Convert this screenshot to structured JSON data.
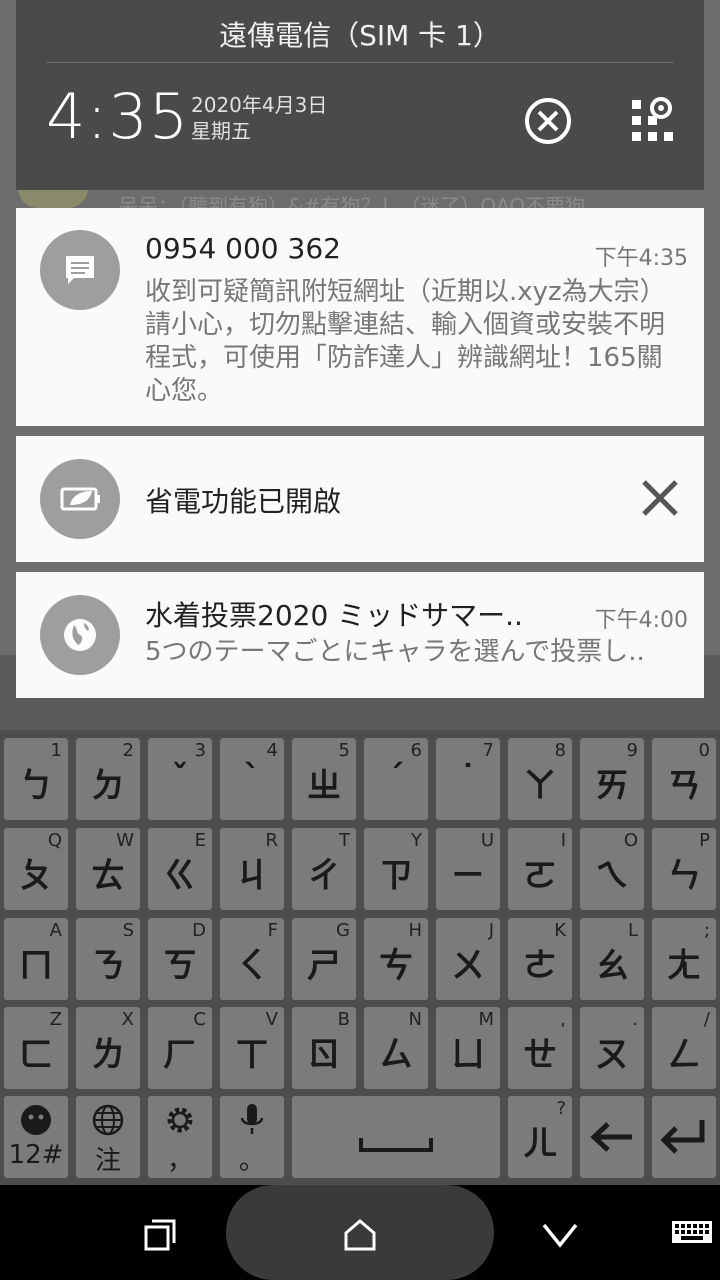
{
  "background": {
    "partial_text": "呆呆：（聽到有狗）&#有狗？！（迷了）QAQ不要狗"
  },
  "shade": {
    "carrier": "遠傳電信（SIM 卡 1）",
    "clock": "4:35",
    "date": "2020年4月3日",
    "weekday": "星期五",
    "clear_icon": "close-circle-icon",
    "settings_icon": "quick-settings-grid-icon"
  },
  "notifications": [
    {
      "app_icon": "message-icon",
      "title": "0954 000 362",
      "time": "下午4:35",
      "body": "收到可疑簡訊附短網址（近期以.xyz為大宗）請小心，切勿點擊連結、輸入個資或安裝不明程式，可使用「防詐達人」辨識網址！165關心您。"
    },
    {
      "app_icon": "battery-leaf-icon",
      "title": "省電功能已開啟",
      "dismiss_icon": "close-icon"
    },
    {
      "app_icon": "globe-icon",
      "title": "水着投票2020 ミッドサマー..",
      "time": "下午4:00",
      "body": "5つのテーマごとにキャラを選んで投票し.."
    }
  ],
  "keyboard": {
    "rows": [
      [
        {
          "main": "ㄅ",
          "hint": "1"
        },
        {
          "main": "ㄉ",
          "hint": "2"
        },
        {
          "main": "ˇ",
          "hint": "3"
        },
        {
          "main": "ˋ",
          "hint": "4"
        },
        {
          "main": "ㄓ",
          "hint": "5"
        },
        {
          "main": "ˊ",
          "hint": "6"
        },
        {
          "main": "˙",
          "hint": "7"
        },
        {
          "main": "ㄚ",
          "hint": "8"
        },
        {
          "main": "ㄞ",
          "hint": "9"
        },
        {
          "main": "ㄢ",
          "hint": "0"
        }
      ],
      [
        {
          "main": "ㄆ",
          "hint": "Q"
        },
        {
          "main": "ㄊ",
          "hint": "W"
        },
        {
          "main": "ㄍ",
          "hint": "E"
        },
        {
          "main": "ㄐ",
          "hint": "R"
        },
        {
          "main": "ㄔ",
          "hint": "T"
        },
        {
          "main": "ㄗ",
          "hint": "Y"
        },
        {
          "main": "ㄧ",
          "hint": "U"
        },
        {
          "main": "ㄛ",
          "hint": "I"
        },
        {
          "main": "ㄟ",
          "hint": "O"
        },
        {
          "main": "ㄣ",
          "hint": "P"
        }
      ],
      [
        {
          "main": "ㄇ",
          "hint": "A"
        },
        {
          "main": "ㄋ",
          "hint": "S"
        },
        {
          "main": "ㄎ",
          "hint": "D"
        },
        {
          "main": "ㄑ",
          "hint": "F"
        },
        {
          "main": "ㄕ",
          "hint": "G"
        },
        {
          "main": "ㄘ",
          "hint": "H"
        },
        {
          "main": "ㄨ",
          "hint": "J"
        },
        {
          "main": "ㄜ",
          "hint": "K"
        },
        {
          "main": "ㄠ",
          "hint": "L"
        },
        {
          "main": "ㄤ",
          "hint": ";"
        }
      ],
      [
        {
          "main": "ㄈ",
          "hint": "Z"
        },
        {
          "main": "ㄌ",
          "hint": "X"
        },
        {
          "main": "ㄏ",
          "hint": "C"
        },
        {
          "main": "ㄒ",
          "hint": "V"
        },
        {
          "main": "ㄖ",
          "hint": "B"
        },
        {
          "main": "ㄙ",
          "hint": "N"
        },
        {
          "main": "ㄩ",
          "hint": "M"
        },
        {
          "main": "ㄝ",
          "hint": ","
        },
        {
          "main": "ㄡ",
          "hint": "."
        },
        {
          "main": "ㄥ",
          "hint": "/"
        }
      ]
    ],
    "bottom": {
      "emoji_sub": "12#",
      "lang_sub": "注",
      "settings_sub": "，",
      "mic_sub": "。",
      "er_main": "ㄦ",
      "er_hint": "?"
    }
  },
  "navbar": {
    "recents_icon": "recents-icon",
    "home_icon": "home-icon",
    "back_icon": "back-chevron-icon",
    "keyboard_icon": "keyboard-icon"
  }
}
